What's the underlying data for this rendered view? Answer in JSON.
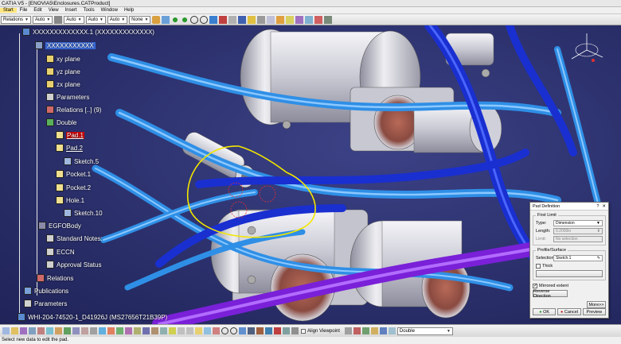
{
  "window": {
    "title": "CATIA V5 - [ENOVIA5\\Enclosures.CATProduct]"
  },
  "menu": [
    "Start",
    "File",
    "Edit",
    "View",
    "Insert",
    "Tools",
    "Window",
    "Help"
  ],
  "toolbar": {
    "dropdowns": [
      {
        "value": "Relations",
        "name": "relations"
      },
      {
        "value": "Auto",
        "name": "auto-1"
      },
      {
        "value": "Auto",
        "name": "auto-2"
      },
      {
        "value": "Auto",
        "name": "auto-3"
      },
      {
        "value": "Auto",
        "name": "auto-4"
      },
      {
        "value": "None",
        "name": "none"
      }
    ]
  },
  "tree": {
    "root": "XXXXXXXXXXXXX.1 (XXXXXXXXXXXXX)",
    "part": "XXXXXXXXXXX",
    "items": [
      {
        "label": "xy plane"
      },
      {
        "label": "yz plane"
      },
      {
        "label": "zx plane"
      },
      {
        "label": "Parameters"
      },
      {
        "label": "Relations [..] (9)"
      },
      {
        "label": "Double"
      },
      {
        "label": "Pad.1"
      },
      {
        "label": "Pad.2"
      },
      {
        "label": "Sketch.5"
      },
      {
        "label": "Pocket.1"
      },
      {
        "label": "Pocket.2"
      },
      {
        "label": "Hole.1"
      },
      {
        "label": "Sketch.10"
      },
      {
        "label": "EGFOBody"
      },
      {
        "label": "Standard Notes:"
      },
      {
        "label": "ECCN"
      },
      {
        "label": "Approval Status"
      },
      {
        "label": "Relations"
      },
      {
        "label": "Publications"
      },
      {
        "label": "Parameters"
      },
      {
        "label": "WHI-204-74520-1_D41926J (MS27656T21B39P)"
      }
    ]
  },
  "dialog": {
    "title": "Pad Definition",
    "title_buttons": [
      "?",
      "✕"
    ],
    "first_limit": {
      "legend": "First Limit",
      "type_label": "Type:",
      "type_value": "Dimension",
      "length_label": "Length:",
      "length_value": "0.2000in",
      "limit_label": "Limit:",
      "limit_value": "No selection"
    },
    "profile": {
      "legend": "Profile/Surface",
      "selection_label": "Selection:",
      "selection_value": "Sketch.1",
      "thick_label": "Thick"
    },
    "mirrored_label": "Mirrored extent",
    "reverse_label": "Reverse Direction",
    "more_label": "More>>",
    "ok_label": "OK",
    "cancel_label": "Cancel",
    "preview_label": "Preview"
  },
  "bottombar": {
    "align_label": "Align Viewpoint",
    "double_value": "Double"
  },
  "status": {
    "text": "Select new data to edit the pad."
  },
  "colors": {
    "background": "#2a2f66",
    "tube_light": "#2f8fe6",
    "tube_dark": "#1a2fd0",
    "tube_violet": "#8a2fe0",
    "annotation": "#f2e600",
    "selected": "#d40000"
  }
}
